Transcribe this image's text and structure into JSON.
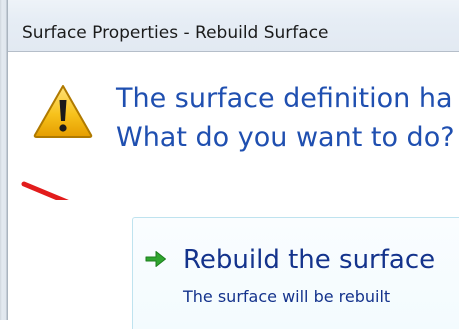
{
  "window": {
    "title": "Surface Properties - Rebuild Surface"
  },
  "dialog": {
    "main_instruction_line1": "The surface definition ha",
    "main_instruction_line2": "What do you want to do?",
    "icon": "warning-icon"
  },
  "command_link": {
    "title": "Rebuild the surface",
    "description": "The surface will be rebuilt",
    "icon": "green-arrow-icon"
  },
  "annotation": {
    "icon": "red-pointer-arrow",
    "color": "#e21c1c"
  },
  "colors": {
    "instruction_text": "#1f4fb0",
    "link_text": "#14338c",
    "link_arrow": "#2fa52f"
  }
}
